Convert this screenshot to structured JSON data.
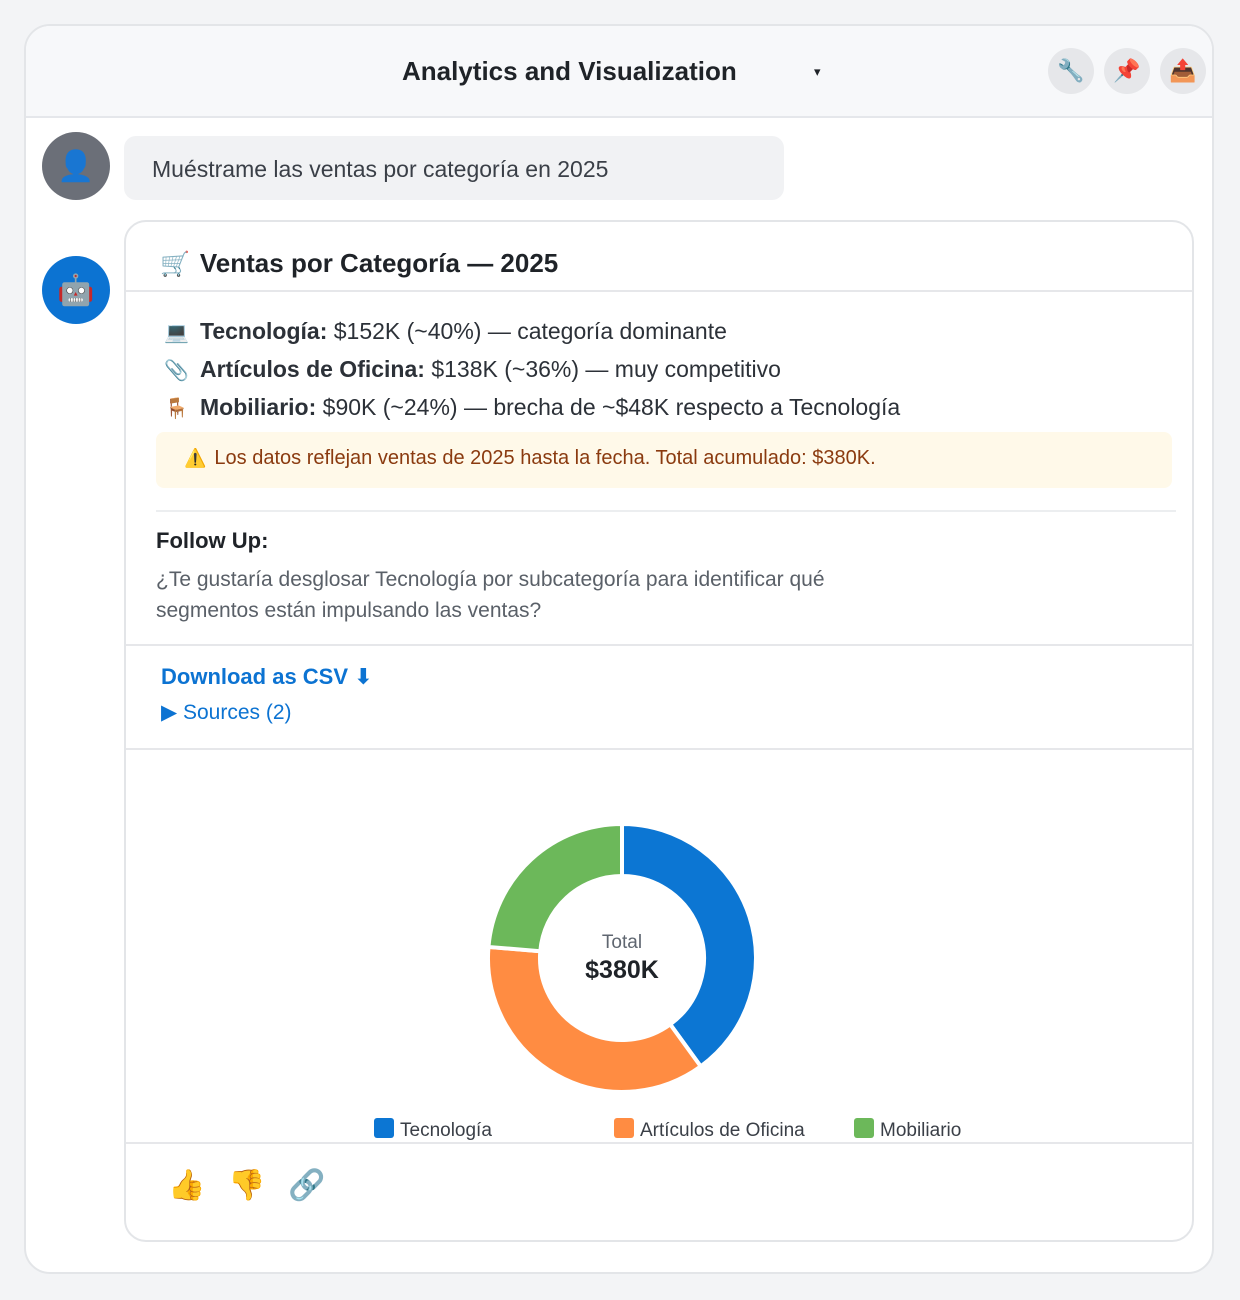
{
  "header": {
    "title": "Analytics and Visualization",
    "caret_icon": "▾",
    "buttons": [
      {
        "name": "wrench-button",
        "glyph": "🔧"
      },
      {
        "name": "pin-button",
        "glyph": "📌"
      },
      {
        "name": "share-button",
        "glyph": "📤"
      }
    ]
  },
  "conversation": {
    "user_avatar_glyph": "👤",
    "user_message": "Muéstrame las ventas por categoría en 2025",
    "bot_avatar_glyph": "🤖"
  },
  "response": {
    "title_emoji": "🛒",
    "title": "Ventas por Categoría — 2025",
    "bullets": [
      {
        "icon": "💻",
        "label": "Tecnología:",
        "text": " $152K (~40%) — categoría dominante"
      },
      {
        "icon": "📎",
        "label": "Artículos de Oficina:",
        "text": " $138K (~36%) — muy competitivo"
      },
      {
        "icon": "🪑",
        "label": "Mobiliario:",
        "text": " $90K (~24%) — brecha de ~$48K respecto a Tecnología"
      }
    ],
    "warning_icon": "⚠️",
    "warning": "Los datos reflejan ventas de 2025 hasta la fecha. Total acumulado: $380K.",
    "follow_up_title": "Follow Up:",
    "follow_up_text": "¿Te gustaría desglosar Tecnología por subcategoría para identificar qué segmentos están impulsando las ventas?",
    "download_csv": "Download as CSV ⬇",
    "sources": "▶ Sources (2)"
  },
  "chart_data": {
    "type": "pie",
    "categories": [
      "Tecnología",
      "Artículos de Oficina",
      "Mobiliario"
    ],
    "values": [
      152,
      138,
      90
    ],
    "colors": [
      "#0c76d3",
      "#ff8c42",
      "#6cb85a"
    ],
    "center_label": "Total",
    "center_value": "$380K",
    "legend_position": "bottom"
  },
  "actions": [
    {
      "name": "thumbs-up-icon",
      "glyph": "👍"
    },
    {
      "name": "thumbs-down-icon",
      "glyph": "👎"
    },
    {
      "name": "link-icon",
      "glyph": "🔗"
    }
  ]
}
